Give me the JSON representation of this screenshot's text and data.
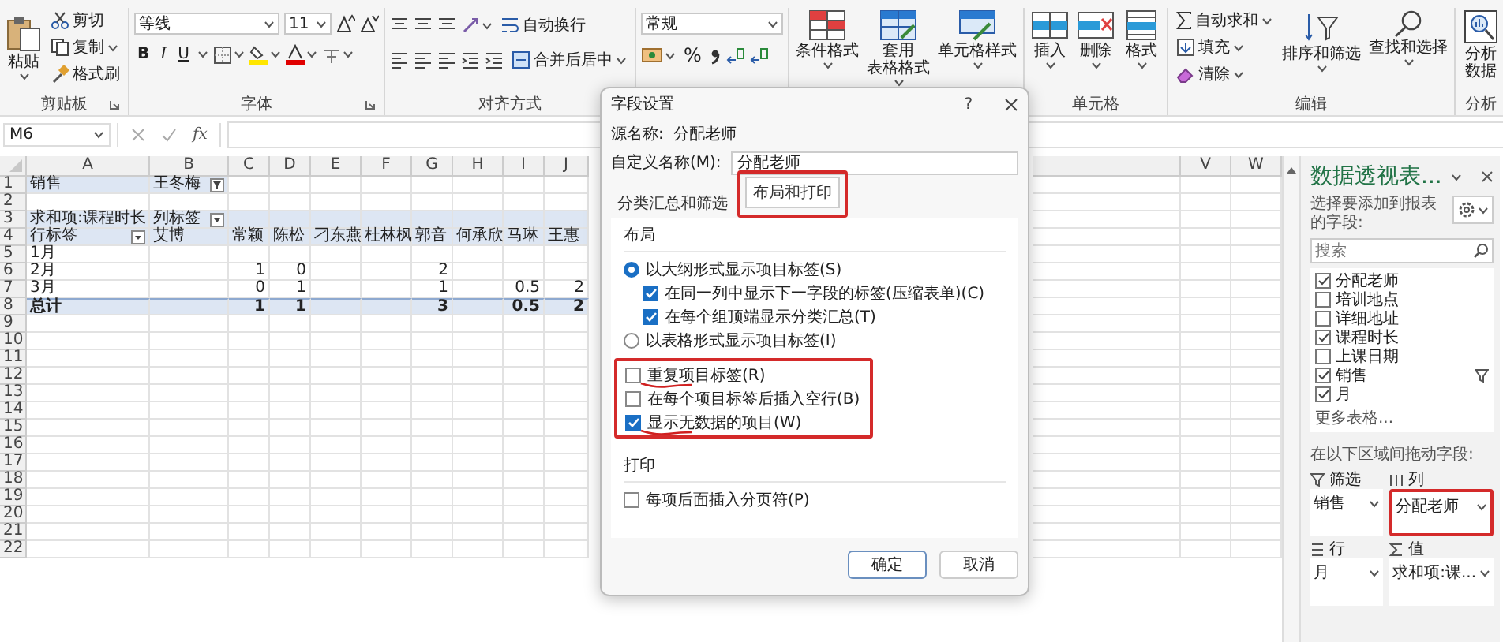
{
  "ribbon": {
    "groups": [
      {
        "kind": "clipboard",
        "label": "剪贴板",
        "paste": "粘贴",
        "items": [
          "剪切",
          "复制",
          "格式刷"
        ]
      },
      {
        "kind": "font",
        "label": "字体",
        "font": "等线",
        "size": "11",
        "styles": [
          "B",
          "I",
          "U"
        ]
      },
      {
        "kind": "alignment",
        "label": "对齐方式",
        "items": [
          "自动换行",
          "合并后居中"
        ]
      },
      {
        "kind": "number",
        "format": "常规",
        "symbols": [
          "%"
        ]
      },
      {
        "kind": "styles",
        "buttons": [
          [
            "条件格式"
          ],
          [
            "套用",
            "表格格式"
          ],
          [
            "单元格样式"
          ]
        ]
      },
      {
        "kind": "cells",
        "label": "单元格",
        "buttons": [
          [
            "插入"
          ],
          [
            "删除"
          ],
          [
            "格式"
          ]
        ]
      },
      {
        "kind": "editing",
        "label": "编辑",
        "items": [
          "自动求和",
          "填充",
          "清除"
        ],
        "buttons": [
          [
            "排序和筛选"
          ],
          [
            "查找和选择"
          ]
        ]
      },
      {
        "kind": "analysis",
        "label": "分析",
        "buttons": [
          [
            "分析",
            "数据"
          ]
        ]
      }
    ]
  },
  "formula_bar": {
    "name_box": "M6",
    "function_label": "fx"
  },
  "sheet": {
    "columns": [
      "A",
      "B",
      "C",
      "D",
      "E",
      "F",
      "G",
      "H",
      "I",
      "J"
    ],
    "far_columns": [
      "V",
      "W"
    ],
    "rows": [
      {
        "number": "1",
        "kind": "filter",
        "cells": [
          {
            "text": "销售"
          },
          {
            "text": "王冬梅",
            "filter_button": true
          }
        ]
      },
      {
        "number": "2"
      },
      {
        "number": "3",
        "kind": "header",
        "cells": [
          {
            "text": "求和项:课程时长"
          },
          {
            "text": "列标签",
            "dropdown_button": true
          }
        ]
      },
      {
        "number": "4",
        "kind": "header",
        "cells": [
          {
            "text": "行标签",
            "dropdown_button": true
          },
          {
            "text": "艾博"
          },
          {
            "text": "常颖"
          },
          {
            "text": "陈松"
          },
          {
            "text": "刁东燕"
          },
          {
            "text": "杜林枫"
          },
          {
            "text": "郭音"
          },
          {
            "text": "何承欣"
          },
          {
            "text": "马琳"
          },
          {
            "text": "王惠"
          }
        ]
      },
      {
        "number": "5",
        "cells": [
          {
            "text": "1月"
          }
        ]
      },
      {
        "number": "6",
        "cells": [
          {
            "text": "2月"
          },
          null,
          {
            "text": "1",
            "kind": "number"
          },
          {
            "text": "0",
            "kind": "number"
          },
          null,
          null,
          {
            "text": "2",
            "kind": "number"
          }
        ]
      },
      {
        "number": "7",
        "cells": [
          {
            "text": "3月"
          },
          null,
          {
            "text": "0",
            "kind": "number"
          },
          {
            "text": "1",
            "kind": "number"
          },
          null,
          null,
          {
            "text": "1",
            "kind": "number"
          },
          null,
          {
            "text": "0.5",
            "kind": "number"
          },
          {
            "text": "2",
            "kind": "number"
          }
        ]
      },
      {
        "number": "8",
        "kind": "total",
        "cells": [
          {
            "text": "总计"
          },
          null,
          {
            "text": "1",
            "kind": "number"
          },
          {
            "text": "1",
            "kind": "number"
          },
          null,
          null,
          {
            "text": "3",
            "kind": "number"
          },
          null,
          {
            "text": "0.5",
            "kind": "number"
          },
          {
            "text": "2",
            "kind": "number"
          }
        ]
      },
      {
        "number": "9"
      },
      {
        "number": "10"
      },
      {
        "number": "11"
      },
      {
        "number": "12"
      },
      {
        "number": "13"
      },
      {
        "number": "14"
      },
      {
        "number": "15"
      },
      {
        "number": "16"
      },
      {
        "number": "17"
      },
      {
        "number": "18"
      },
      {
        "number": "19"
      },
      {
        "number": "20"
      },
      {
        "number": "21"
      },
      {
        "number": "22"
      }
    ]
  },
  "dialog": {
    "title": "字段设置",
    "help": "?",
    "source_label": "源名称:",
    "source_value": "分配老师",
    "custom_label": "自定义名称(M):",
    "custom_value": "分配老师",
    "tabs": [
      {
        "label": "分类汇总和筛选",
        "selected": false
      },
      {
        "label": "布局和打印",
        "selected": true,
        "annotated": true
      }
    ],
    "sections": [
      {
        "title": "布局",
        "options": [
          {
            "kind": "radio",
            "label": "以大纲形式显示项目标签(S)",
            "selected": true,
            "children": [
              {
                "kind": "checkbox",
                "label": "在同一列中显示下一字段的标签(压缩表单)(C)",
                "checked": true
              },
              {
                "kind": "checkbox",
                "label": "在每个组顶端显示分类汇总(T)",
                "checked": true
              }
            ]
          },
          {
            "kind": "radio",
            "label": "以表格形式显示项目标签(I)",
            "selected": false
          },
          {
            "kind": "checkbox",
            "label": "重复项目标签(R)",
            "checked": false,
            "annotated": true,
            "marked": true
          },
          {
            "kind": "checkbox",
            "label": "在每个项目标签后插入空行(B)",
            "checked": false,
            "annotated": true
          },
          {
            "kind": "checkbox",
            "label": "显示无数据的项目(W)",
            "checked": true,
            "annotated": true,
            "marked": true
          }
        ]
      },
      {
        "title": "打印",
        "options": [
          {
            "kind": "checkbox",
            "label": "每项后面插入分页符(P)",
            "checked": false
          }
        ]
      }
    ],
    "buttons": [
      {
        "label": "确定",
        "default": true
      },
      {
        "label": "取消",
        "default": false
      }
    ]
  },
  "pivot_pane": {
    "title": "数据透视表...",
    "description": "选择要添加到报表的字段:",
    "search_placeholder": "搜索",
    "fields": [
      {
        "label": "分配老师",
        "checked": true
      },
      {
        "label": "培训地点",
        "checked": false
      },
      {
        "label": "详细地址",
        "checked": false
      },
      {
        "label": "课程时长",
        "checked": true
      },
      {
        "label": "上课日期",
        "checked": false
      },
      {
        "label": "销售",
        "checked": true,
        "filtered": true
      },
      {
        "label": "月",
        "checked": true
      }
    ],
    "more": "更多表格...",
    "areas_hint": "在以下区域间拖动字段:",
    "areas": [
      {
        "kind": "filter",
        "label": "筛选",
        "items": [
          "销售"
        ]
      },
      {
        "kind": "columns",
        "label": "列",
        "items": [
          "分配老师"
        ],
        "annotated": true
      },
      {
        "kind": "rows",
        "label": "行",
        "items": [
          "月"
        ]
      },
      {
        "kind": "values",
        "label": "值",
        "items": [
          "求和项:课..."
        ]
      }
    ]
  }
}
